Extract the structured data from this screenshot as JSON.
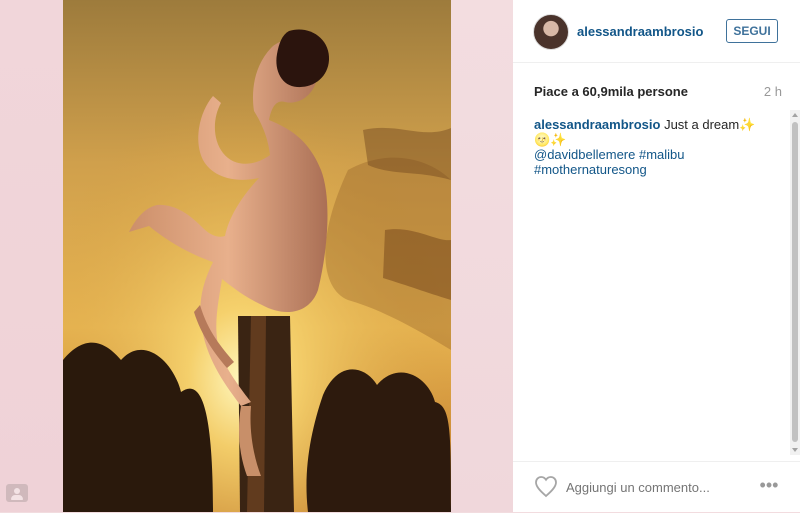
{
  "post": {
    "username": "alessandraambrosio",
    "follow_label": "SEGUI",
    "likes_text": "Piace a 60,9mila persone",
    "timestamp": "2 h",
    "caption_user": "alessandraambrosio",
    "caption_text": "Just a dream✨🌝✨",
    "caption_mention": "@davidbellemere",
    "caption_tag1": "#malibu",
    "caption_tag2": "#mothernaturesong"
  },
  "actions": {
    "comment_placeholder": "Aggiungi un commento...",
    "more_label": "•••"
  },
  "colors": {
    "link": "#125688",
    "follow_border": "#3f729b",
    "sky_top": "#d9b15a",
    "sun_glow": "#fff1a6"
  },
  "icons": {
    "heart": "heart-icon",
    "more": "ellipsis-icon",
    "lock": "account-icon"
  }
}
